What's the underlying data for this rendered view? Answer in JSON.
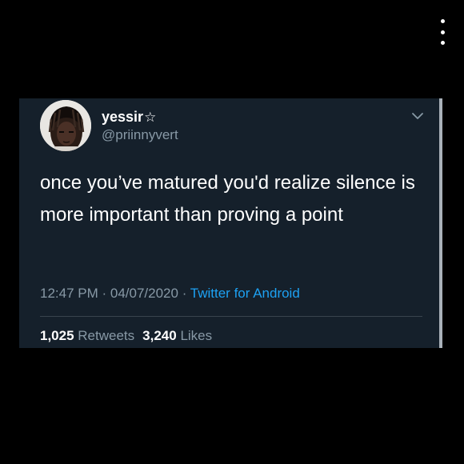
{
  "colors": {
    "background": "#000000",
    "card": "#15202b",
    "primary_text": "#ffffff",
    "secondary_text": "#8899a6",
    "link": "#1da1f2",
    "divider": "#38444d"
  },
  "screen": {
    "menu_icon": "vertical-dots-icon"
  },
  "tweet": {
    "display_name": "yessir",
    "name_icon": "star-outline-icon",
    "name_icon_glyph": "☆",
    "handle": "@priinnyvert",
    "caret_icon": "chevron-down-icon",
    "text": "once you’ve matured you'd realize silence is more important than proving a point",
    "time": "12:47 PM",
    "separator": " · ",
    "date": "04/07/2020",
    "source": "Twitter for Android",
    "retweets_count": "1,025",
    "retweets_label": "Retweets",
    "likes_count": "3,240",
    "likes_label": "Likes"
  }
}
